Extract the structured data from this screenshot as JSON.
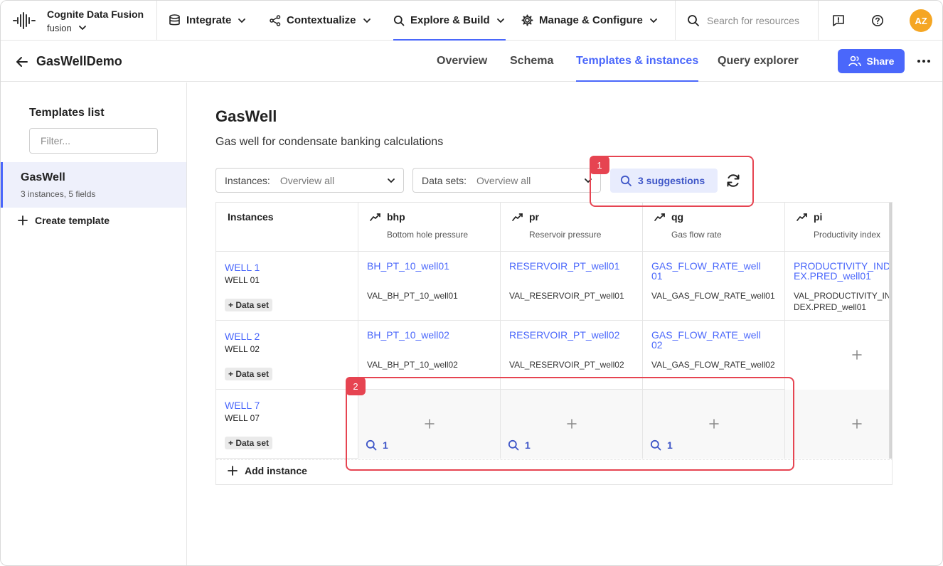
{
  "app": {
    "brand_name": "Cognite Data Fusion",
    "project": "fusion",
    "nav": [
      {
        "label": "Integrate",
        "icon": "database-icon"
      },
      {
        "label": "Contextualize",
        "icon": "share-nodes-icon"
      },
      {
        "label": "Explore & Build",
        "icon": "search-icon",
        "active": true
      },
      {
        "label": "Manage & Configure",
        "icon": "gear-icon"
      }
    ],
    "search_placeholder": "Search for resources",
    "avatar_initials": "AZ",
    "accent_color": "#4a67fb"
  },
  "page": {
    "title": "GasWellDemo",
    "tabs": [
      "Overview",
      "Schema",
      "Templates & instances",
      "Query explorer"
    ],
    "active_tab": "Templates & instances",
    "share_label": "Share"
  },
  "sidebar": {
    "title": "Templates list",
    "filter_placeholder": "Filter...",
    "items": [
      {
        "name": "GasWell",
        "meta": "3 instances, 5 fields"
      }
    ],
    "create_label": "Create template"
  },
  "template": {
    "name": "GasWell",
    "description": "Gas well for condensate banking calculations",
    "instances_filter": {
      "label": "Instances:",
      "value": "Overview all"
    },
    "datasets_filter": {
      "label": "Data sets:",
      "value": "Overview all"
    },
    "suggestions_label": "3 suggestions",
    "callouts": [
      "1",
      "2"
    ]
  },
  "table": {
    "instances_header": "Instances",
    "fields": [
      {
        "name": "bhp",
        "desc": "Bottom hole pressure"
      },
      {
        "name": "pr",
        "desc": "Reservoir pressure"
      },
      {
        "name": "qg",
        "desc": "Gas flow rate"
      },
      {
        "name": "pi",
        "desc": "Productivity index"
      }
    ],
    "rows": [
      {
        "name": "WELL 1",
        "external_id": "WELL 01",
        "dataset_label": "+ Data set",
        "cells": [
          {
            "link": "BH_PT_10_well01",
            "value": "VAL_BH_PT_10_well01"
          },
          {
            "link": "RESERVOIR_PT_well01",
            "value": "VAL_RESERVOIR_PT_well01"
          },
          {
            "link": "GAS_FLOW_RATE_well01",
            "value": "VAL_GAS_FLOW_RATE_well01"
          },
          {
            "link": "PRODUCTIVITY_INDEX.PRED_well01",
            "value": "VAL_PRODUCTIVITY_INDEX.PRED_well01"
          }
        ]
      },
      {
        "name": "WELL 2",
        "external_id": "WELL 02",
        "dataset_label": "+ Data set",
        "cells": [
          {
            "link": "BH_PT_10_well02",
            "value": "VAL_BH_PT_10_well02"
          },
          {
            "link": "RESERVOIR_PT_well02",
            "value": "VAL_RESERVOIR_PT_well02"
          },
          {
            "link": "GAS_FLOW_RATE_well02",
            "value": "VAL_GAS_FLOW_RATE_well02"
          },
          {
            "empty": true
          }
        ]
      },
      {
        "name": "WELL 7",
        "external_id": "WELL 07",
        "dataset_label": "+ Data set",
        "cells": [
          {
            "empty": true,
            "suggestions": "1"
          },
          {
            "empty": true,
            "suggestions": "1"
          },
          {
            "empty": true,
            "suggestions": "1"
          },
          {
            "empty": true
          }
        ]
      }
    ],
    "add_instance_label": "Add instance"
  }
}
